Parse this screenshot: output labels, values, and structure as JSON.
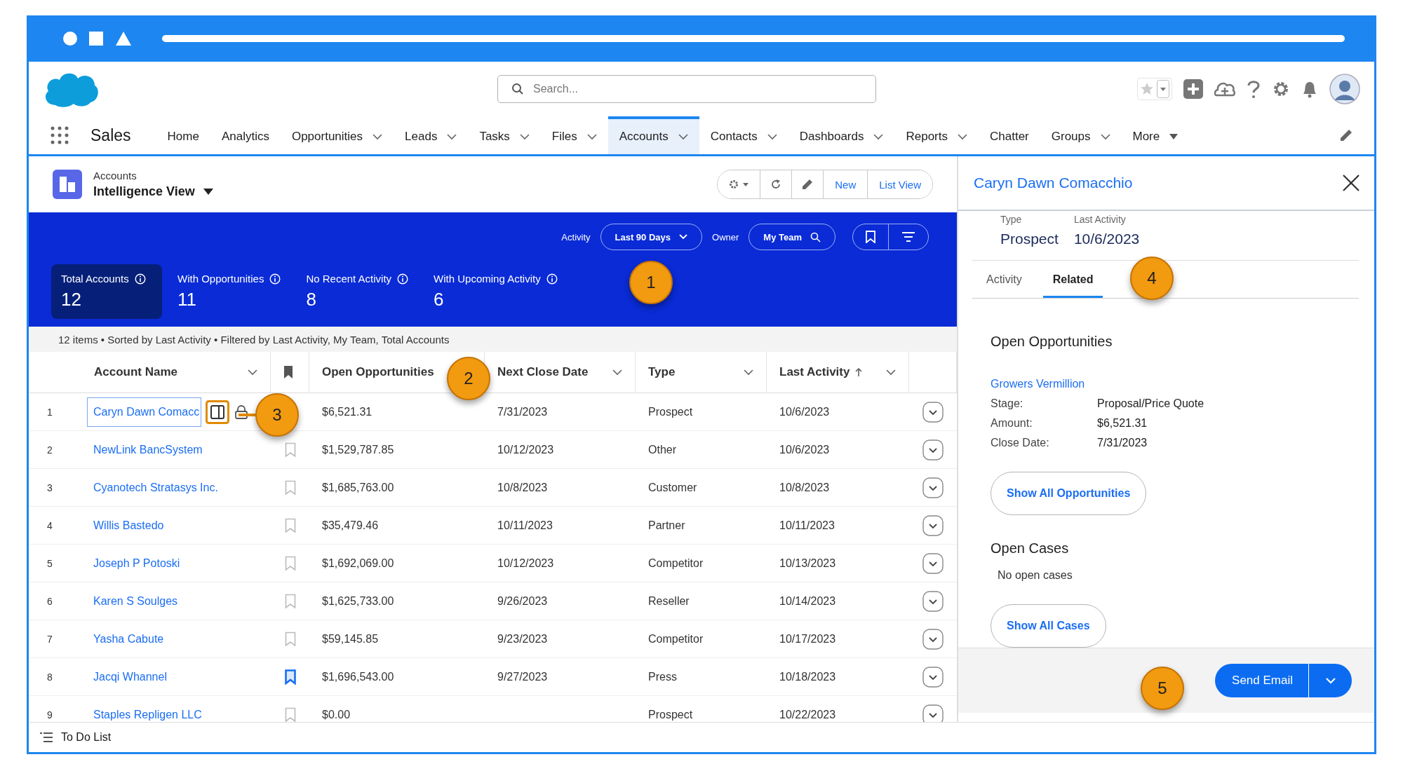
{
  "header": {
    "search": {
      "placeholder": "Search..."
    }
  },
  "nav": {
    "app_name": "Sales",
    "items": [
      {
        "label": "Home",
        "dropdown": false,
        "selected": false
      },
      {
        "label": "Analytics",
        "dropdown": false,
        "selected": false
      },
      {
        "label": "Opportunities",
        "dropdown": true,
        "filled": false,
        "selected": false
      },
      {
        "label": "Leads",
        "dropdown": true,
        "filled": false,
        "selected": false
      },
      {
        "label": "Tasks",
        "dropdown": true,
        "filled": false,
        "selected": false
      },
      {
        "label": "Files",
        "dropdown": true,
        "filled": false,
        "selected": false
      },
      {
        "label": "Accounts",
        "dropdown": true,
        "filled": false,
        "selected": true
      },
      {
        "label": "Contacts",
        "dropdown": true,
        "filled": false,
        "selected": false
      },
      {
        "label": "Dashboards",
        "dropdown": true,
        "filled": false,
        "selected": false
      },
      {
        "label": "Reports",
        "dropdown": true,
        "filled": false,
        "selected": false
      },
      {
        "label": "Chatter",
        "dropdown": false,
        "selected": false
      },
      {
        "label": "Groups",
        "dropdown": true,
        "filled": false,
        "selected": false
      },
      {
        "label": "More",
        "dropdown": true,
        "filled": true,
        "selected": false
      }
    ]
  },
  "page_header": {
    "object": "Accounts",
    "view": "Intelligence View",
    "actions": [
      {
        "kind": "gear"
      },
      {
        "kind": "refresh"
      },
      {
        "kind": "edit"
      },
      {
        "kind": "text",
        "label": "New"
      },
      {
        "kind": "text",
        "label": "List View"
      }
    ]
  },
  "band": {
    "filters": [
      {
        "label": "Activity",
        "value": "Last 90 Days",
        "kind": "dropdown"
      },
      {
        "label": "Owner",
        "value": "My Team",
        "kind": "search"
      }
    ],
    "stats": [
      {
        "label": "Total Accounts",
        "value": "12",
        "selected": true
      },
      {
        "label": "With Opportunities",
        "value": "11",
        "selected": false
      },
      {
        "label": "No Recent Activity",
        "value": "8",
        "selected": false
      },
      {
        "label": "With Upcoming Activity",
        "value": "6",
        "selected": false
      }
    ]
  },
  "summary": "12 items • Sorted by Last Activity • Filtered by Last Activity, My Team, Total Accounts",
  "table": {
    "columns": [
      {
        "kind": "text",
        "label": "Account Name",
        "menu": true,
        "sorted": false
      },
      {
        "kind": "bookmark"
      },
      {
        "kind": "text",
        "label": "Open Opportunities",
        "menu": false,
        "sorted": false
      },
      {
        "kind": "text",
        "label": "Next Close Date",
        "menu": true,
        "sorted": false
      },
      {
        "kind": "text",
        "label": "Type",
        "menu": true,
        "sorted": false
      },
      {
        "kind": "text",
        "label": "Last Activity",
        "menu": true,
        "sorted": true
      }
    ],
    "rows": [
      {
        "number": "1",
        "account": "Caryn Dawn Comacc",
        "focused": true,
        "open_opportunities": "$6,521.31",
        "next_close_date": "7/31/2023",
        "type": "Prospect",
        "last_activity": "10/6/2023"
      },
      {
        "number": "2",
        "account": "NewLink BancSystem",
        "focused": false,
        "bookmarked": false,
        "open_opportunities": "$1,529,787.85",
        "next_close_date": "10/12/2023",
        "type": "Other",
        "last_activity": "10/6/2023"
      },
      {
        "number": "3",
        "account": "Cyanotech Stratasys Inc.",
        "focused": false,
        "bookmarked": false,
        "open_opportunities": "$1,685,763.00",
        "next_close_date": "10/8/2023",
        "type": "Customer",
        "last_activity": "10/8/2023"
      },
      {
        "number": "4",
        "account": "Willis Bastedo",
        "focused": false,
        "bookmarked": false,
        "open_opportunities": "$35,479.46",
        "next_close_date": "10/11/2023",
        "type": "Partner",
        "last_activity": "10/11/2023"
      },
      {
        "number": "5",
        "account": "Joseph P Potoski",
        "focused": false,
        "bookmarked": false,
        "open_opportunities": "$1,692,069.00",
        "next_close_date": "10/12/2023",
        "type": "Competitor",
        "last_activity": "10/13/2023"
      },
      {
        "number": "6",
        "account": "Karen S Soulges",
        "focused": false,
        "bookmarked": false,
        "open_opportunities": "$1,625,733.00",
        "next_close_date": "9/26/2023",
        "type": "Reseller",
        "last_activity": "10/14/2023"
      },
      {
        "number": "7",
        "account": "Yasha Cabute",
        "focused": false,
        "bookmarked": false,
        "open_opportunities": "$59,145.85",
        "next_close_date": "9/23/2023",
        "type": "Competitor",
        "last_activity": "10/17/2023"
      },
      {
        "number": "8",
        "account": "Jacqi Whannel",
        "focused": false,
        "bookmarked": true,
        "open_opportunities": "$1,696,543.00",
        "next_close_date": "9/27/2023",
        "type": "Press",
        "last_activity": "10/18/2023"
      },
      {
        "number": "9",
        "account": "Staples Repligen LLC",
        "focused": false,
        "bookmarked": false,
        "open_opportunities": "$0.00",
        "type": "Prospect",
        "last_activity": "10/22/2023"
      }
    ]
  },
  "footer": {
    "label": "To Do List"
  },
  "detail_panel": {
    "title": "Caryn Dawn Comacchio",
    "fields": [
      {
        "label": "Type",
        "value": "Prospect"
      },
      {
        "label": "Last Activity",
        "value": "10/6/2023"
      }
    ],
    "tabs": [
      {
        "label": "Activity",
        "selected": false
      },
      {
        "label": "Related",
        "selected": true
      }
    ],
    "opportunities": {
      "heading": "Open Opportunities",
      "name": "Growers Vermillion",
      "details": [
        {
          "label": "Stage:",
          "value": "Proposal/Price Quote"
        },
        {
          "label": "Amount:",
          "value": "$6,521.31"
        },
        {
          "label": "Close Date:",
          "value": "7/31/2023"
        }
      ],
      "button": "Show All Opportunities"
    },
    "cases": {
      "heading": "Open Cases",
      "empty_text": "No open cases",
      "button": "Show All Cases"
    },
    "action": "Send Email"
  },
  "callouts": [
    "1",
    "2",
    "3",
    "4",
    "5"
  ]
}
